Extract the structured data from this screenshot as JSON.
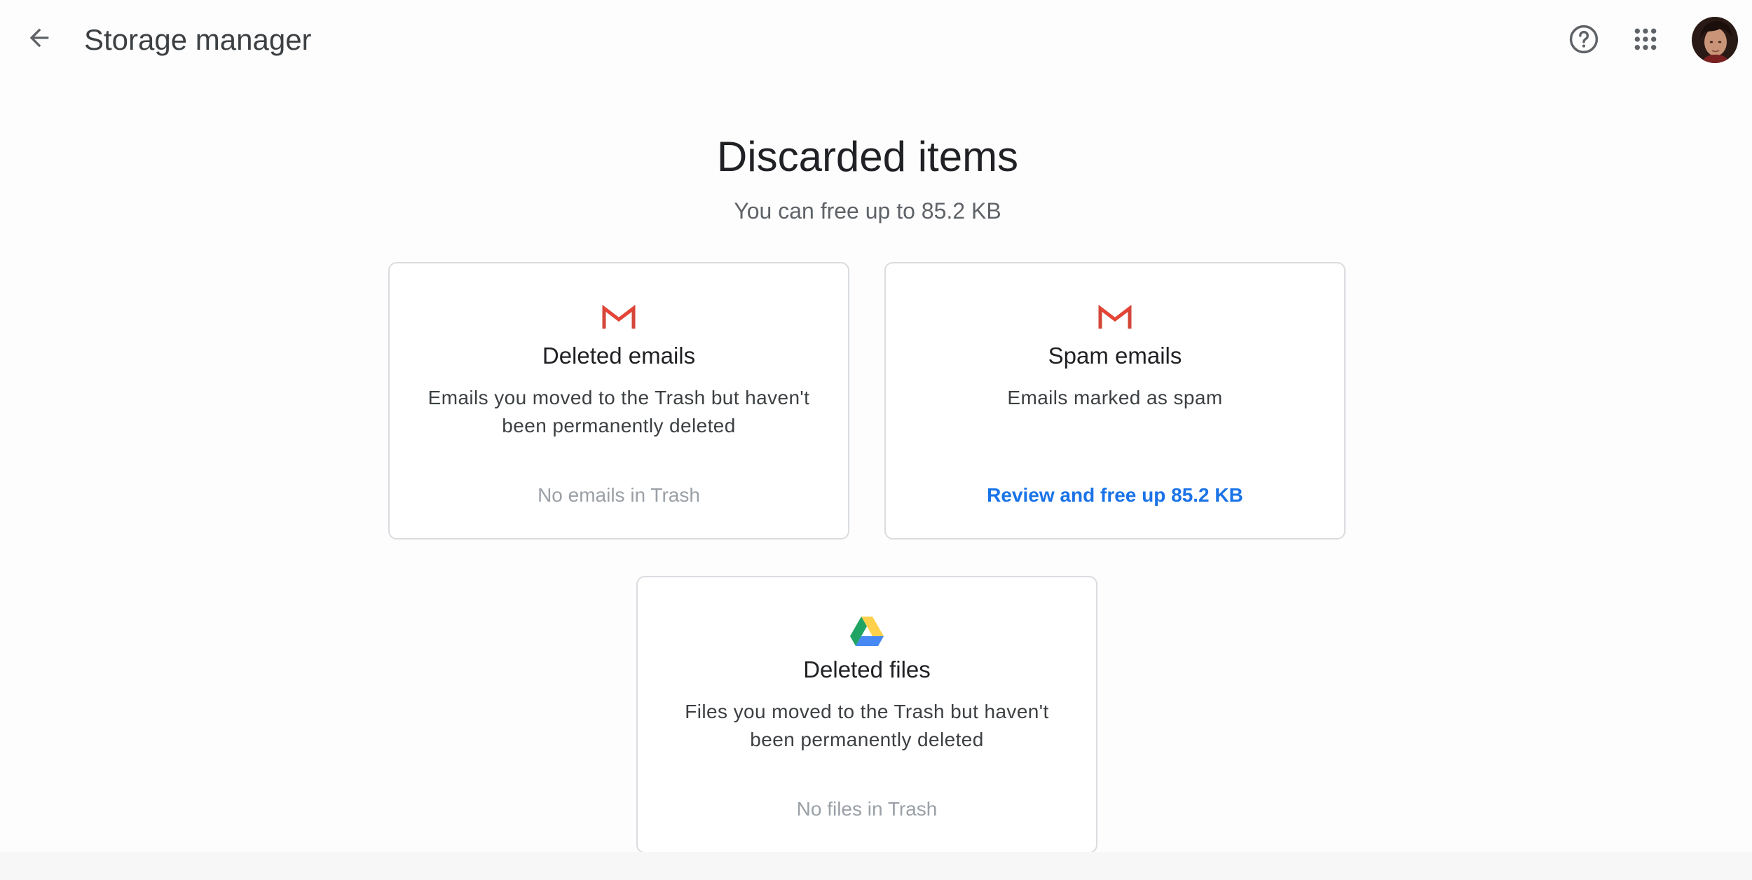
{
  "header": {
    "title": "Storage manager",
    "back_icon": "arrow-back-icon",
    "help_icon": "help-circle-icon",
    "apps_icon": "apps-grid-icon"
  },
  "main": {
    "heading": "Discarded items",
    "subtitle": "You can free up to 85.2 KB"
  },
  "cards": [
    {
      "icon": "gmail-icon",
      "title": "Deleted emails",
      "description": "Emails you moved to the Trash but haven't been permanently deleted",
      "status": "No emails in Trash"
    },
    {
      "icon": "gmail-icon",
      "title": "Spam emails",
      "description": "Emails marked as spam",
      "action": "Review and free up 85.2 KB"
    },
    {
      "icon": "google-drive-icon",
      "title": "Deleted files",
      "description": "Files you moved to the Trash but haven't been permanently deleted",
      "status": "No files in Trash"
    }
  ],
  "colors": {
    "link": "#1a73e8",
    "muted": "#9aa0a6",
    "gmail_red": "#d44638",
    "drive_green": "#1fa463",
    "drive_yellow": "#ffd04b",
    "drive_blue": "#4688f4"
  }
}
